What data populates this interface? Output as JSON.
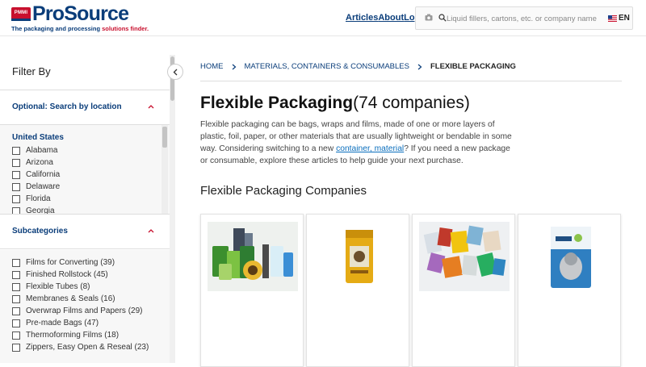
{
  "header": {
    "logo_badge": "PMMI",
    "logo_text": "ProSource",
    "tagline_a": "The packaging and processing ",
    "tagline_b": "solutions finder.",
    "nav": [
      "Articles",
      "About",
      "Login"
    ],
    "search_placeholder": "Liquid fillers, cartons, etc. or company name",
    "language": "EN"
  },
  "sidebar": {
    "title": "Filter By",
    "location_section": "Optional: Search by location",
    "location_group": "United States",
    "states": [
      "Alabama",
      "Arizona",
      "California",
      "Delaware",
      "Florida",
      "Georgia"
    ],
    "subcategories_section": "Subcategories",
    "subcategories": [
      "Films for Converting (39)",
      "Finished Rollstock (45)",
      "Flexible Tubes (8)",
      "Membranes & Seals (16)",
      "Overwrap Films and Papers (29)",
      "Pre-made Bags (47)",
      "Thermoforming Films (18)",
      "Zippers, Easy Open & Reseal (23)"
    ]
  },
  "breadcrumb": [
    "HOME",
    "MATERIALS, CONTAINERS & CONSUMABLES",
    "FLEXIBLE PACKAGING"
  ],
  "main": {
    "title": "Flexible Packaging",
    "count": "(74 companies)",
    "desc_a": "Flexible packaging can be bags, wraps and films, made of one or more layers of plastic, foil, paper, or other materials that are usually lightweight or bendable in some way. Considering switching to a new ",
    "desc_link": "container, material",
    "desc_b": "? If you need a new package or consumable, explore these articles to help guide your next purchase.",
    "section_title": "Flexible Packaging Companies"
  },
  "colors": {
    "brand_blue": "#0a3d7a",
    "brand_red": "#c8102e",
    "link": "#0a6ebd"
  },
  "cards": [
    {
      "image": "flexible-pouches-assortment"
    },
    {
      "image": "yellow-stand-up-pouch"
    },
    {
      "image": "assorted-bags-collage"
    },
    {
      "image": "blue-cat-food-pouch"
    }
  ]
}
